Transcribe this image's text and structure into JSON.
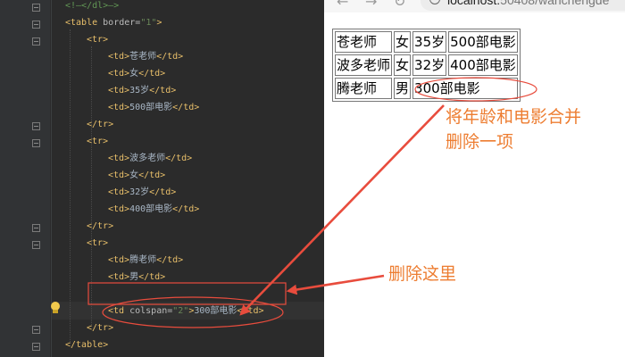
{
  "editor": {
    "lines": [
      {
        "indent": 0,
        "parts": [
          {
            "c": "cmt",
            "t": "<!—</dl>—>"
          }
        ]
      },
      {
        "indent": 0,
        "parts": [
          {
            "c": "tag",
            "t": "<table "
          },
          {
            "c": "attr",
            "t": "border="
          },
          {
            "c": "str",
            "t": "\"1\""
          },
          {
            "c": "tag",
            "t": ">"
          }
        ]
      },
      {
        "indent": 1,
        "parts": [
          {
            "c": "tag",
            "t": "<tr>"
          }
        ]
      },
      {
        "indent": 2,
        "parts": [
          {
            "c": "tag",
            "t": "<td>"
          },
          {
            "c": "txt",
            "t": "苍老师"
          },
          {
            "c": "tag",
            "t": "</td>"
          }
        ]
      },
      {
        "indent": 2,
        "parts": [
          {
            "c": "tag",
            "t": "<td>"
          },
          {
            "c": "txt",
            "t": "女"
          },
          {
            "c": "tag",
            "t": "</td>"
          }
        ]
      },
      {
        "indent": 2,
        "parts": [
          {
            "c": "tag",
            "t": "<td>"
          },
          {
            "c": "txt",
            "t": "35岁"
          },
          {
            "c": "tag",
            "t": "</td>"
          }
        ]
      },
      {
        "indent": 2,
        "parts": [
          {
            "c": "tag",
            "t": "<td>"
          },
          {
            "c": "txt",
            "t": "500部电影"
          },
          {
            "c": "tag",
            "t": "</td>"
          }
        ]
      },
      {
        "indent": 1,
        "parts": [
          {
            "c": "tag",
            "t": "</tr>"
          }
        ]
      },
      {
        "indent": 1,
        "parts": [
          {
            "c": "tag",
            "t": "<tr>"
          }
        ]
      },
      {
        "indent": 2,
        "parts": [
          {
            "c": "tag",
            "t": "<td>"
          },
          {
            "c": "txt",
            "t": "波多老师"
          },
          {
            "c": "tag",
            "t": "</td>"
          }
        ]
      },
      {
        "indent": 2,
        "parts": [
          {
            "c": "tag",
            "t": "<td>"
          },
          {
            "c": "txt",
            "t": "女"
          },
          {
            "c": "tag",
            "t": "</td>"
          }
        ]
      },
      {
        "indent": 2,
        "parts": [
          {
            "c": "tag",
            "t": "<td>"
          },
          {
            "c": "txt",
            "t": "32岁"
          },
          {
            "c": "tag",
            "t": "</td>"
          }
        ]
      },
      {
        "indent": 2,
        "parts": [
          {
            "c": "tag",
            "t": "<td>"
          },
          {
            "c": "txt",
            "t": "400部电影"
          },
          {
            "c": "tag",
            "t": "</td>"
          }
        ]
      },
      {
        "indent": 1,
        "parts": [
          {
            "c": "tag",
            "t": "</tr>"
          }
        ]
      },
      {
        "indent": 1,
        "parts": [
          {
            "c": "tag",
            "t": "<tr>"
          }
        ]
      },
      {
        "indent": 2,
        "parts": [
          {
            "c": "tag",
            "t": "<td>"
          },
          {
            "c": "txt",
            "t": "腾老师"
          },
          {
            "c": "tag",
            "t": "</td>"
          }
        ]
      },
      {
        "indent": 2,
        "parts": [
          {
            "c": "tag",
            "t": "<td>"
          },
          {
            "c": "txt",
            "t": "男"
          },
          {
            "c": "tag",
            "t": "</td>"
          }
        ]
      },
      {
        "indent": 2,
        "parts": []
      },
      {
        "indent": 2,
        "parts": [
          {
            "c": "tag",
            "t": "<td "
          },
          {
            "c": "attr",
            "t": "colspan="
          },
          {
            "c": "str",
            "t": "\"2\""
          },
          {
            "c": "tag",
            "t": ">"
          },
          {
            "c": "txt",
            "t": "300部电影"
          },
          {
            "c": "tag",
            "t": "</td>"
          }
        ]
      },
      {
        "indent": 1,
        "parts": [
          {
            "c": "tag",
            "t": "</tr>"
          }
        ]
      },
      {
        "indent": 0,
        "parts": [
          {
            "c": "tag",
            "t": "</table>"
          }
        ]
      }
    ]
  },
  "browser": {
    "back_icon": "back-arrow-icon",
    "forward_icon": "forward-arrow-icon",
    "reload_icon": "reload-icon",
    "address_host": "localhost:",
    "address_path": "50408/wanchengde"
  },
  "table": {
    "rows": [
      [
        {
          "text": "苍老师"
        },
        {
          "text": "女"
        },
        {
          "text": "35岁"
        },
        {
          "text": "500部电影"
        }
      ],
      [
        {
          "text": "波多老师"
        },
        {
          "text": "女"
        },
        {
          "text": "32岁"
        },
        {
          "text": "400部电影"
        }
      ],
      [
        {
          "text": "腾老师"
        },
        {
          "text": "男"
        },
        {
          "text": "300部电影",
          "colspan": 2
        }
      ]
    ]
  },
  "annotations": {
    "merge_note_line1": "将年龄和电影合并",
    "merge_note_line2": "删除一项",
    "delete_note": "删除这里",
    "color": "#ed7d31",
    "line_color": "#e84c3d"
  }
}
